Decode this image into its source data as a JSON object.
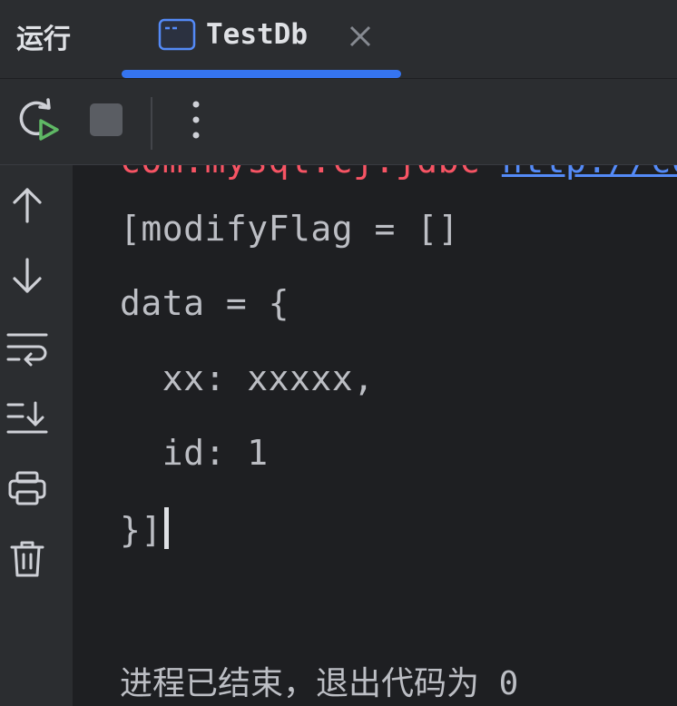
{
  "header": {
    "title": "运行",
    "tab": {
      "label": "TestDb",
      "active": true
    }
  },
  "toolbar": {
    "rerun_icon": "rerun-icon",
    "stop_icon": "stop-icon",
    "more_icon": "more-vertical-icon"
  },
  "rail": {
    "icons": [
      "arrow-up-icon",
      "arrow-down-icon",
      "soft-wrap-icon",
      "scroll-to-end-icon",
      "print-icon",
      "trash-icon"
    ]
  },
  "console": {
    "partial_line": {
      "text": "com.mysql.cj.jdbc ",
      "link": "http://com.my"
    },
    "lines": [
      "[modifyFlag = []",
      "data = {",
      "  xx: xxxxx,",
      "  id: 1",
      "}]"
    ],
    "exit_message": "进程已结束，退出代码为 0"
  },
  "colors": {
    "background": "#1e1f22",
    "panel": "#2b2d30",
    "accent": "#3574f0",
    "error_text": "#f75464",
    "run_green": "#5fb865"
  }
}
